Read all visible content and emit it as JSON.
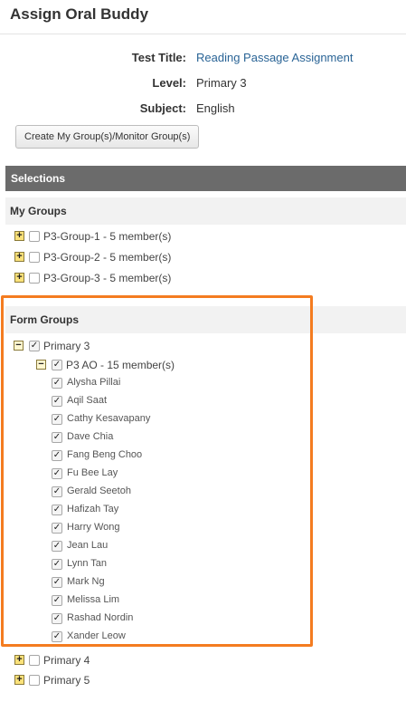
{
  "header": {
    "title": "Assign Oral Buddy"
  },
  "info": {
    "test_title_label": "Test Title:",
    "test_title_value": "Reading Passage Assignment",
    "level_label": "Level:",
    "level_value": "Primary 3",
    "subject_label": "Subject:",
    "subject_value": "English"
  },
  "create_button_label": "Create My Group(s)/Monitor Group(s)",
  "selections_label": "Selections",
  "my_groups": {
    "title": "My Groups",
    "items": [
      {
        "label": "P3-Group-1 - 5 member(s)",
        "checked": false
      },
      {
        "label": "P3-Group-2 - 5 member(s)",
        "checked": false
      },
      {
        "label": "P3-Group-3 - 5 member(s)",
        "checked": false
      }
    ]
  },
  "form_groups": {
    "title": "Form Groups",
    "levels": [
      {
        "label": "Primary 3",
        "checked": true,
        "expanded": true
      },
      {
        "label": "Primary 4",
        "checked": false,
        "expanded": false
      },
      {
        "label": "Primary 5",
        "checked": false,
        "expanded": false
      }
    ],
    "class": {
      "label": "P3 AO - 15 member(s)",
      "checked": true,
      "expanded": true
    },
    "members": [
      "Alysha Pillai",
      "Aqil Saat",
      "Cathy Kesavapany",
      "Dave Chia",
      "Fang Beng Choo",
      "Fu Bee Lay",
      "Gerald Seetoh",
      "Hafizah Tay",
      "Harry Wong",
      "Jean Lau",
      "Lynn Tan",
      "Mark Ng",
      "Melissa Lim",
      "Rashad Nordin",
      "Xander Leow"
    ]
  },
  "icons": {
    "expand": "+",
    "collapse": "−",
    "check": "✓"
  },
  "colors": {
    "highlight": "#f47c20",
    "link": "#2a6496",
    "selection_bar": "#6b6b6b"
  }
}
